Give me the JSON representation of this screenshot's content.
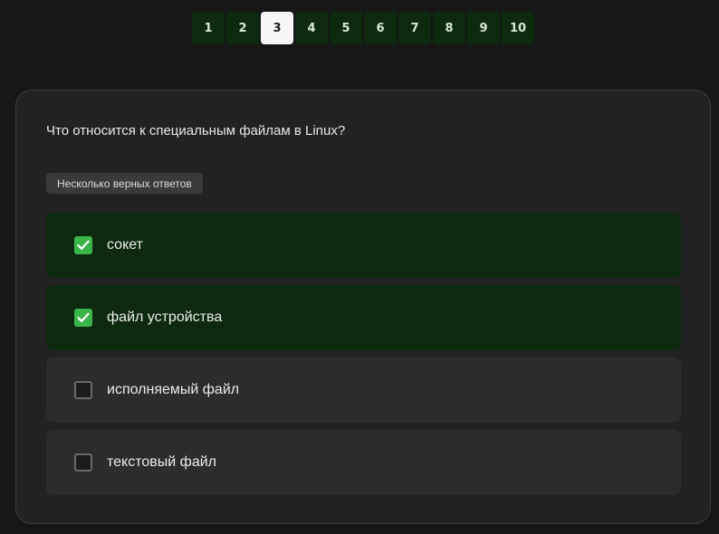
{
  "pager": {
    "pages": [
      "1",
      "2",
      "3",
      "4",
      "5",
      "6",
      "7",
      "8",
      "9",
      "10"
    ],
    "current_index": 2
  },
  "quiz": {
    "question": "Что относится к специальным файлам в Linux?",
    "mode_badge": "Несколько верных ответов",
    "options": [
      {
        "label": "сокет",
        "checked": true
      },
      {
        "label": "файл устройства",
        "checked": true
      },
      {
        "label": "исполняемый файл",
        "checked": false
      },
      {
        "label": "текстовый файл",
        "checked": false
      }
    ]
  },
  "colors": {
    "accent_green": "#3bb54a",
    "selected_bg": "#0d2a0f",
    "card_bg": "#222222"
  },
  "icons": {
    "checkbox_checked": "check-icon"
  }
}
